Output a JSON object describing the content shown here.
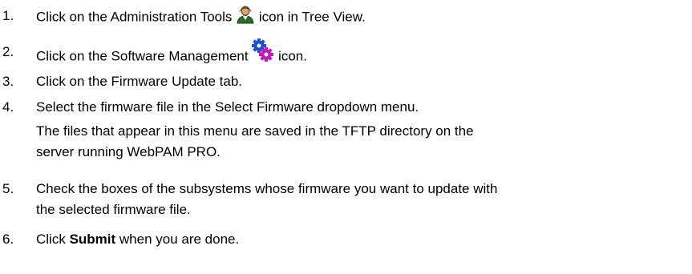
{
  "steps": [
    {
      "number": "1.",
      "text_before": "Click on the Administration Tools ",
      "icon": "administration-tools-person-icon",
      "text_after": " icon in Tree View."
    },
    {
      "number": "2.",
      "text_before": "Click on the Software Management ",
      "icon": "software-management-gears-icon",
      "text_after": " icon."
    },
    {
      "number": "3.",
      "text": "Click on the Firmware Update tab."
    },
    {
      "number": "4.",
      "text": "Select the firmware file in the Select Firmware dropdown menu.",
      "note_line1": "The files that appear in this menu are saved in the TFTP directory on the",
      "note_line2": "server running WebPAM PRO."
    },
    {
      "number": "5.",
      "line1": "Check the boxes of the subsystems whose firmware you want to update with",
      "line2": "the selected firmware file."
    },
    {
      "number": "6.",
      "text_before": "Click ",
      "bold": "Submit",
      "text_after": " when you are done."
    }
  ],
  "colors": {
    "person_icon_body": "#2e6b2e",
    "person_icon_head": "#d9a66b",
    "gear_blue": "#1a4fd6",
    "gear_magenta": "#c21ac2"
  }
}
